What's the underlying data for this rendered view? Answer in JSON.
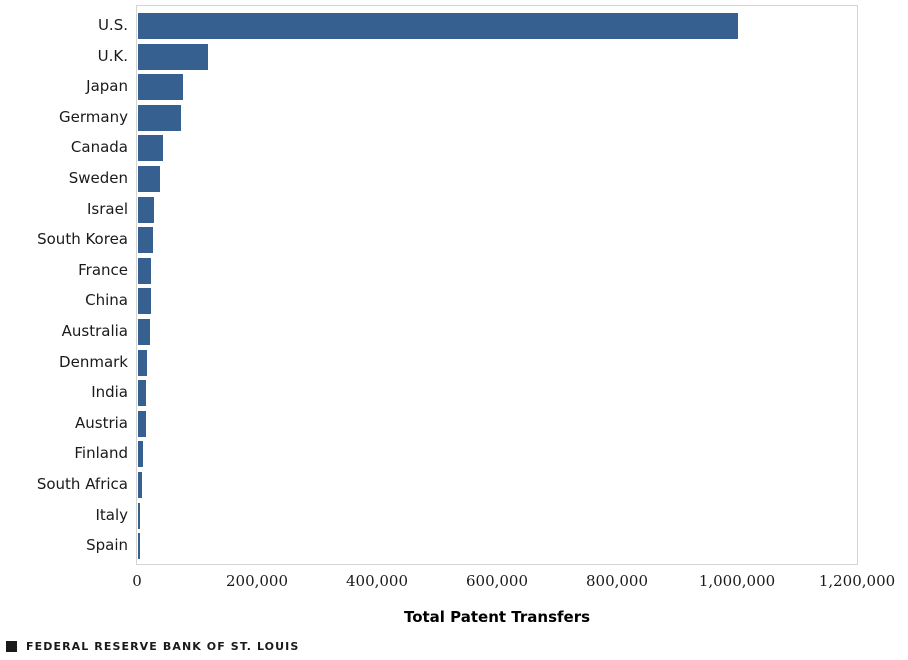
{
  "chart_data": {
    "type": "bar",
    "orientation": "horizontal",
    "title": "",
    "xlabel": "Total Patent Transfers",
    "ylabel": "",
    "xlim": [
      0,
      1200000
    ],
    "xticks": [
      0,
      200000,
      400000,
      600000,
      800000,
      1000000,
      1200000
    ],
    "xtick_labels": [
      "0",
      "200,000",
      "400,000",
      "600,000",
      "800,000",
      "1,000,000",
      "1,200,000"
    ],
    "grid": false,
    "legend": null,
    "bar_color": "#36608f",
    "categories": [
      "U.S.",
      "U.K.",
      "Japan",
      "Germany",
      "Canada",
      "Sweden",
      "Israel",
      "South Korea",
      "France",
      "China",
      "Australia",
      "Denmark",
      "India",
      "Austria",
      "Finland",
      "South Africa",
      "Italy",
      "Spain"
    ],
    "values": [
      1000000,
      116000,
      75000,
      72000,
      42000,
      37000,
      26000,
      25000,
      22000,
      21000,
      20000,
      15000,
      14000,
      13000,
      9000,
      7000,
      4000,
      4000
    ]
  },
  "footer": {
    "mark": "square-mark",
    "text": "FEDERAL RESERVE BANK OF ST. LOUIS"
  }
}
